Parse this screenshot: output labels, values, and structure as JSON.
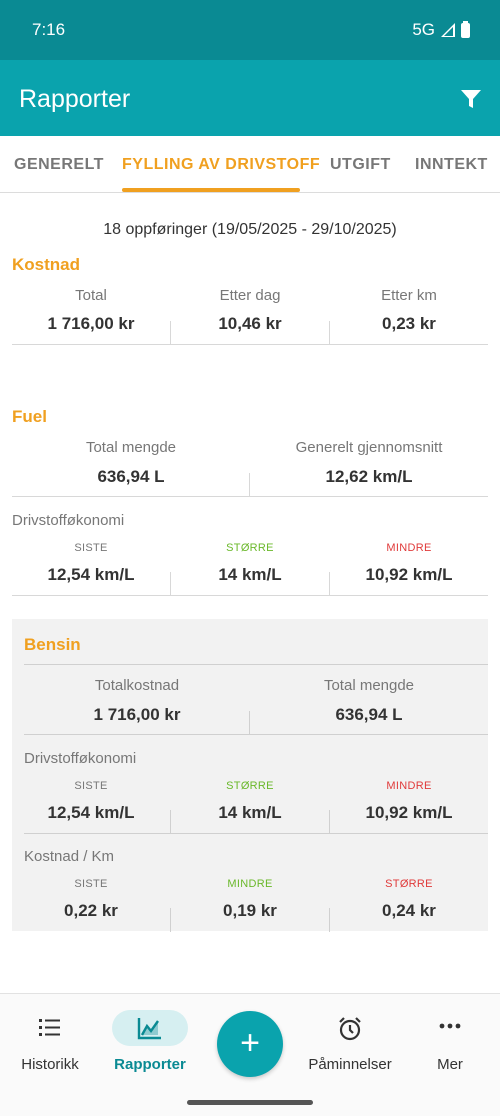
{
  "status": {
    "time": "7:16",
    "network": "5G"
  },
  "app": {
    "title": "Rapporter"
  },
  "tabs": [
    {
      "label": "GENERELT"
    },
    {
      "label": "FYLLING AV DRIVSTOFF"
    },
    {
      "label": "UTGIFT"
    },
    {
      "label": "INNTEKT"
    }
  ],
  "summary": {
    "entries": "18 oppføringer (19/05/2025 - 29/10/2025)"
  },
  "kostnad": {
    "title": "Kostnad",
    "total_label": "Total",
    "total_value": "1 716,00 kr",
    "per_day_label": "Etter dag",
    "per_day_value": "10,46 kr",
    "per_km_label": "Etter km",
    "per_km_value": "0,23 kr"
  },
  "fuel": {
    "title": "Fuel",
    "total_label": "Total mengde",
    "total_value": "636,94 L",
    "avg_label": "Generelt gjennomsnitt",
    "avg_value": "12,62 km/L",
    "economy_heading": "Drivstofføkonomi",
    "last_label": "SISTE",
    "last_value": "12,54 km/L",
    "high_label": "STØRRE",
    "high_value": "14 km/L",
    "low_label": "MINDRE",
    "low_value": "10,92 km/L"
  },
  "bensin": {
    "title": "Bensin",
    "total_cost_label": "Totalkostnad",
    "total_cost_value": "1 716,00 kr",
    "total_amount_label": "Total mengde",
    "total_amount_value": "636,94 L",
    "economy_heading": "Drivstofføkonomi",
    "last_label": "SISTE",
    "last_value": "12,54 km/L",
    "high_label": "STØRRE",
    "high_value": "14 km/L",
    "low_label": "MINDRE",
    "low_value": "10,92 km/L",
    "cost_km_heading": "Kostnad / Km",
    "ck_last_label": "SISTE",
    "ck_last_value": "0,22 kr",
    "ck_low_label": "MINDRE",
    "ck_low_value": "0,19 kr",
    "ck_high_label": "STØRRE",
    "ck_high_value": "0,24 kr"
  },
  "nav": {
    "history": "Historikk",
    "reports": "Rapporter",
    "reminders": "Påminnelser",
    "more": "Mer"
  },
  "colors": {
    "accent": "#0aa3ad",
    "orange": "#f0a020",
    "green": "#6ab82a",
    "red": "#e03a3a"
  }
}
